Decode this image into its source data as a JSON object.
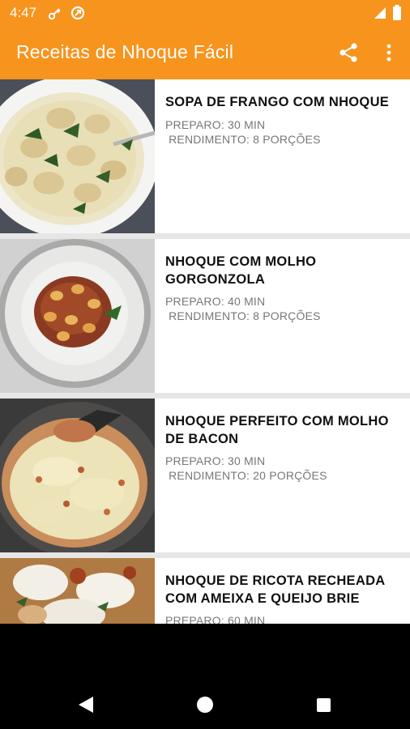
{
  "status_bar": {
    "time": "4:47",
    "icons_left": [
      "bluetooth-key-icon",
      "data-saver-icon"
    ],
    "icons_right": [
      "signal-icon",
      "battery-icon"
    ]
  },
  "app_bar": {
    "title": "Receitas de Nhoque Fácil",
    "color": "#f7941d",
    "actions": [
      "share-icon",
      "more-vert-icon"
    ]
  },
  "recipes": [
    {
      "title": "SOPA DE FRANGO COM NHOQUE",
      "preparo": "PREPARO: 30 MIN",
      "rendimento": " RENDIMENTO: 8 PORÇÕES"
    },
    {
      "title": "NHOQUE COM MOLHO GORGONZOLA",
      "preparo": "PREPARO: 40 MIN",
      "rendimento": " RENDIMENTO: 8 PORÇÕES"
    },
    {
      "title": "NHOQUE PERFEITO COM MOLHO DE BACON",
      "preparo": "PREPARO: 30 MIN",
      "rendimento": " RENDIMENTO: 20 PORÇÕES"
    },
    {
      "title": "NHOQUE DE RICOTA RECHEADA COM AMEIXA E QUEIJO BRIE",
      "preparo": "PREPARO: 60 MIN",
      "rendimento": ""
    }
  ],
  "nav_bar": {
    "buttons": [
      "back-icon",
      "home-icon",
      "recents-icon"
    ]
  }
}
